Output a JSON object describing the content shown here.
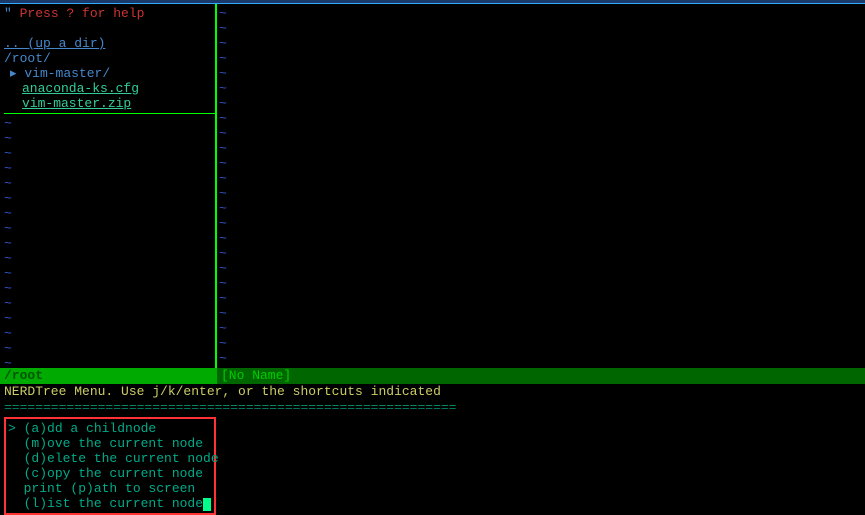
{
  "nerdtree": {
    "help_prefix": "\" ",
    "help": "Press ? for help",
    "updir": ".. (up a dir)",
    "root": "/root/",
    "entries": [
      {
        "type": "dir",
        "arrow": "▸",
        "name": "vim-master/"
      },
      {
        "type": "file",
        "name": "anaconda-ks.cfg"
      },
      {
        "type": "file",
        "name": "vim-master.zip"
      }
    ],
    "tilde": "~"
  },
  "editor": {
    "tilde": "~"
  },
  "status": {
    "left": "/root",
    "right": "[No Name]"
  },
  "menu_hint": "NERDTree Menu. Use j/k/enter, or the shortcuts indicated",
  "divider": "==========================================================",
  "menu": {
    "items": [
      {
        "prefix": "> ",
        "text": "(a)dd a childnode",
        "selected": true
      },
      {
        "prefix": "  ",
        "text": "(m)ove the current node"
      },
      {
        "prefix": "  ",
        "text": "(d)elete the current node"
      },
      {
        "prefix": "  ",
        "text": "(c)opy the current node"
      },
      {
        "prefix": "  ",
        "text": "print (p)ath to screen"
      },
      {
        "prefix": "  ",
        "text": "(l)ist the current node"
      }
    ]
  }
}
